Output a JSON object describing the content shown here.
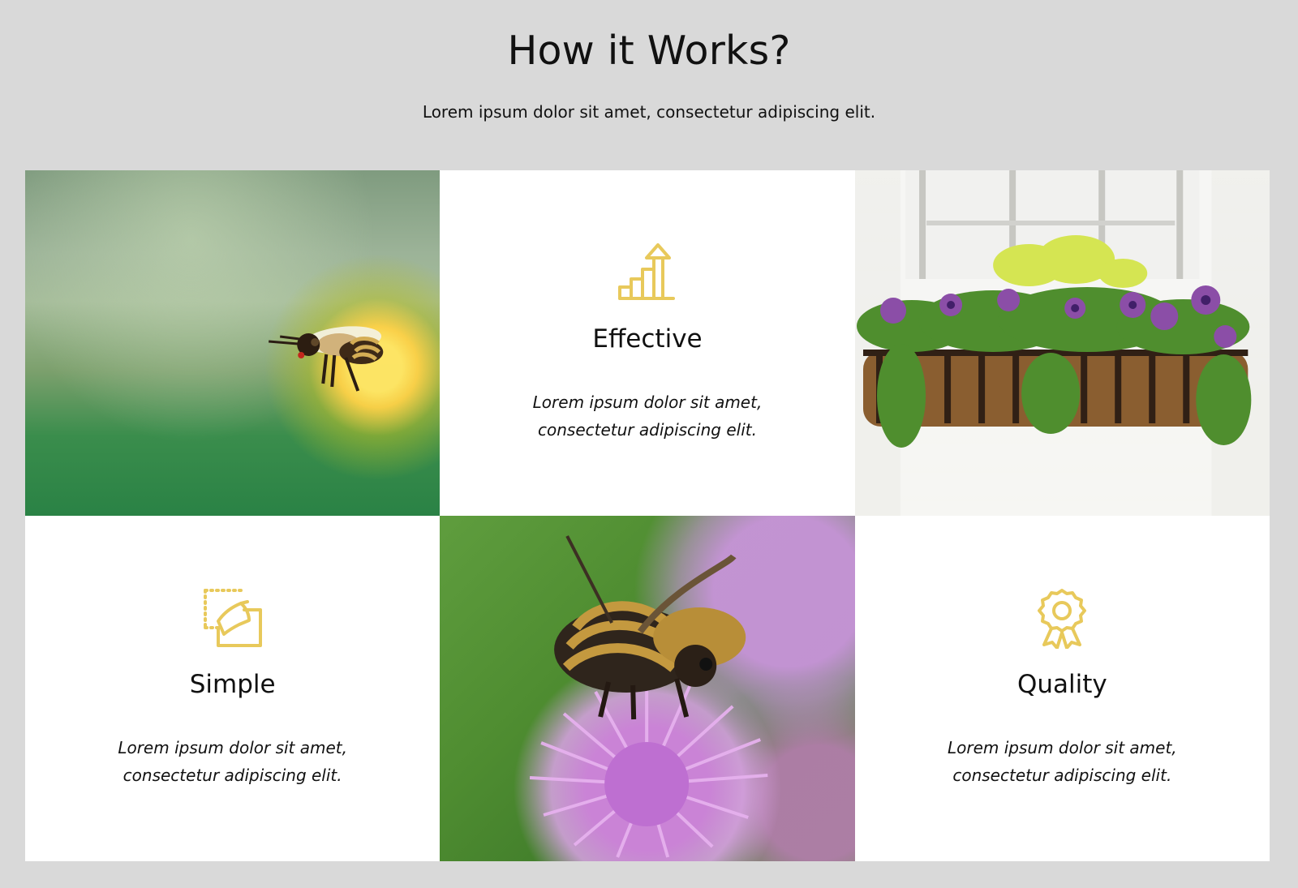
{
  "header": {
    "title": "How it Works?",
    "subtitle": "Lorem ipsum dolor sit amet, consectetur adipiscing elit."
  },
  "features": [
    {
      "title": "Effective",
      "text": "Lorem ipsum dolor sit amet, consectetur adipiscing elit.",
      "icon": "growth-chart-icon"
    },
    {
      "title": "Simple",
      "text": "Lorem ipsum dolor sit amet, consectetur adipiscing elit.",
      "icon": "sticky-note-icon"
    },
    {
      "title": "Quality",
      "text": "Lorem ipsum dolor sit amet, consectetur adipiscing elit.",
      "icon": "award-ribbon-icon"
    }
  ],
  "colors": {
    "background": "#d9d9d9",
    "card": "#ffffff",
    "accent": "#e8c95b",
    "text": "#111111"
  }
}
